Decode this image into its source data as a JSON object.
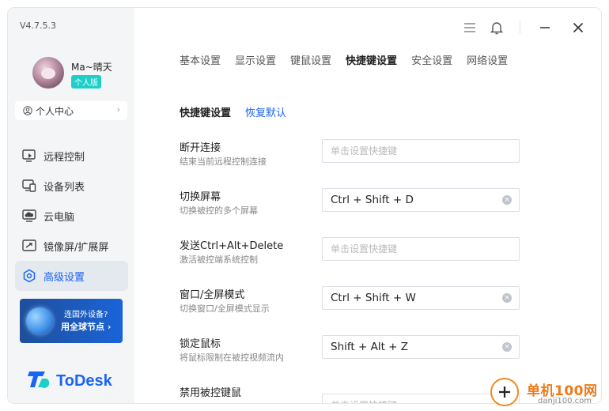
{
  "app": {
    "version": "V4.7.5.3",
    "logo_text": "ToDesk",
    "brand_color": "#1a64f5"
  },
  "user": {
    "name": "Ma~晴天",
    "badge": "个人版",
    "center_label": "个人中心"
  },
  "sidebar": {
    "items": [
      {
        "label": "远程控制",
        "icon": "monitor-remote-icon",
        "active": false
      },
      {
        "label": "设备列表",
        "icon": "devices-icon",
        "active": false
      },
      {
        "label": "云电脑",
        "icon": "cloud-pc-icon",
        "active": false
      },
      {
        "label": "镜像屏/扩展屏",
        "icon": "mirror-screen-icon",
        "active": false
      },
      {
        "label": "高级设置",
        "icon": "settings-hexagon-icon",
        "active": true
      }
    ]
  },
  "promo": {
    "line1": "连国外设备?",
    "line2": "用全球节点 ›"
  },
  "tabs": [
    {
      "label": "基本设置",
      "active": false
    },
    {
      "label": "显示设置",
      "active": false
    },
    {
      "label": "键鼠设置",
      "active": false
    },
    {
      "label": "快捷键设置",
      "active": true
    },
    {
      "label": "安全设置",
      "active": false
    },
    {
      "label": "网络设置",
      "active": false
    }
  ],
  "section": {
    "title": "快捷键设置",
    "restore_label": "恢复默认"
  },
  "shortcuts": [
    {
      "label": "断开连接",
      "desc": "结束当前远程控制连接",
      "value": "",
      "placeholder": "单击设置快捷键"
    },
    {
      "label": "切换屏幕",
      "desc": "切换被控的多个屏幕",
      "value": "Ctrl + Shift + D",
      "placeholder": "单击设置快捷键"
    },
    {
      "label": "发送Ctrl+Alt+Delete",
      "desc": "激活被控端系统控制",
      "value": "",
      "placeholder": "单击设置快捷键"
    },
    {
      "label": "窗口/全屏模式",
      "desc": "切换窗口/全屏模式显示",
      "value": "Ctrl + Shift + W",
      "placeholder": "单击设置快捷键"
    },
    {
      "label": "锁定鼠标",
      "desc": "将鼠标限制在被控视频流内",
      "value": "Shift + Alt + Z",
      "placeholder": "单击设置快捷键"
    },
    {
      "label": "禁用被控键鼠",
      "desc": "",
      "value": "",
      "placeholder": "单击设置快捷键"
    }
  ],
  "watermark": {
    "text": "单机100网",
    "sub": "danji100.com"
  }
}
